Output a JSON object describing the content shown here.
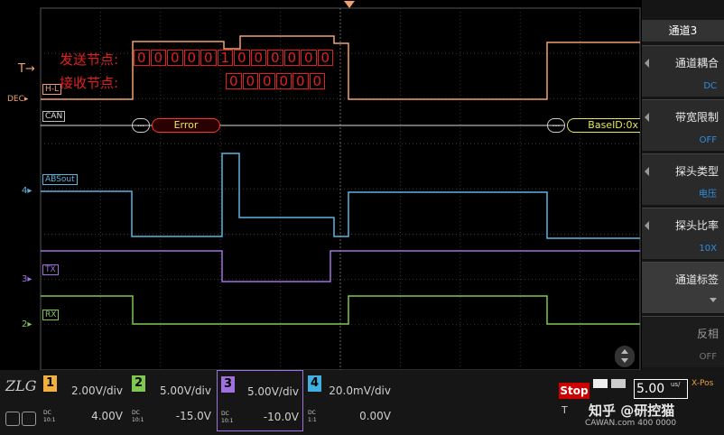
{
  "overlay": {
    "send_label": "发送节点:",
    "send_bits": [
      "0",
      "0",
      "0",
      "0",
      "0",
      "1",
      "0",
      "0",
      "0",
      "0",
      "0",
      "0"
    ],
    "recv_label": "接收节点:",
    "recv_bits": [
      "0",
      "0",
      "0",
      "0",
      "0",
      "0"
    ]
  },
  "markers": {
    "trigger": "T",
    "ch1": "1",
    "ch2": "2",
    "ch3": "3",
    "ch4": "4",
    "dec": "DEC"
  },
  "labels": {
    "hl": "H-L",
    "can": "CAN",
    "absout": "ABSout",
    "tx": "TX",
    "rx": "RX"
  },
  "decode": {
    "error": "Error",
    "baseid": "BaseID:0x"
  },
  "menu": {
    "title": "通道3",
    "items": [
      {
        "label": "通道耦合",
        "value": "DC"
      },
      {
        "label": "带宽限制",
        "value": "OFF"
      },
      {
        "label": "探头类型",
        "value": "电压"
      },
      {
        "label": "探头比率",
        "value": "10X"
      },
      {
        "label": "通道标签",
        "value": ""
      },
      {
        "label": "反相",
        "value": "OFF"
      }
    ]
  },
  "channels": [
    {
      "num": "1",
      "vdiv": "2.00V/div",
      "offset": "4.00V",
      "coupling": "DC",
      "ratio": "10:1",
      "color": "#f0b040"
    },
    {
      "num": "2",
      "vdiv": "5.00V/div",
      "offset": "-15.0V",
      "coupling": "DC",
      "ratio": "10:1",
      "color": "#7fc850"
    },
    {
      "num": "3",
      "vdiv": "5.00V/div",
      "offset": "-10.0V",
      "coupling": "DC",
      "ratio": "10:1",
      "color": "#a070e0"
    },
    {
      "num": "4",
      "vdiv": "20.0mV/div",
      "offset": "0.00V",
      "coupling": "DC",
      "ratio": "1:1",
      "color": "#40b0e0"
    }
  ],
  "status": {
    "run_state": "Stop",
    "timebase": "5.00",
    "timebase_unit": "us/",
    "xpos": "X-Pos",
    "watermark": "知乎 @研控猫",
    "watermark_small": "CAWAN.com 400 0000"
  },
  "colors": {
    "ch1": "#f0a070",
    "ch2": "#7fc850",
    "ch3": "#a070e0",
    "ch4": "#5ab4e0",
    "overlay_red": "#e02020",
    "decode_yellow": "#e8e85a",
    "decode_red": "#ff3030",
    "soft_key_blue": "#2f8fe0"
  }
}
